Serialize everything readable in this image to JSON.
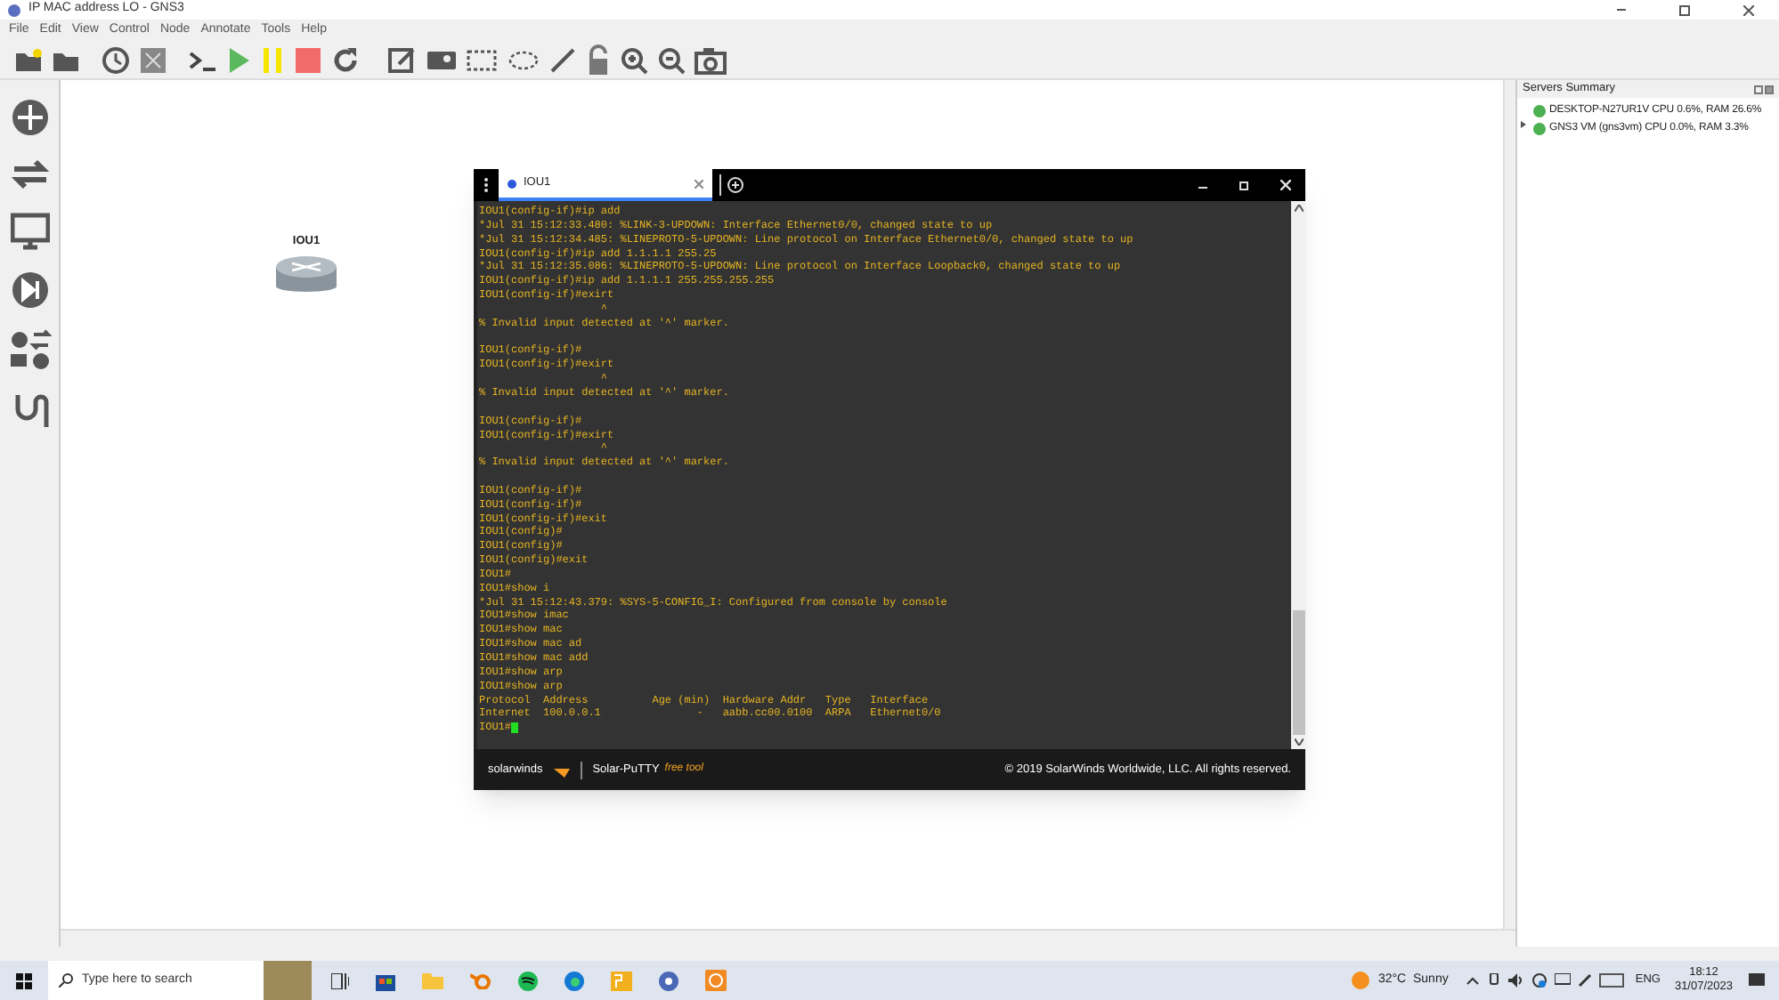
{
  "window": {
    "title": "IP MAC address LO - GNS3"
  },
  "menu": [
    "File",
    "Edit",
    "View",
    "Control",
    "Node",
    "Annotate",
    "Tools",
    "Help"
  ],
  "canvas": {
    "nodes": [
      {
        "label": "IOU1"
      }
    ]
  },
  "servers_summary": {
    "title": "Servers Summary",
    "items": [
      {
        "kind": "leaf",
        "text": "DESKTOP-N27UR1V CPU 0.6%, RAM 26.6%",
        "color": "#4caf50"
      },
      {
        "kind": "branch",
        "text": "GNS3 VM (gns3vm) CPU 0.0%, RAM 3.3%",
        "color": "#4caf50"
      }
    ]
  },
  "terminal": {
    "tabs": [
      {
        "label": "IOU1",
        "selected": true
      }
    ],
    "output": "IOU1(config-if)#ip add\n*Jul 31 15:12:33.480: %LINK-3-UPDOWN: Interface Ethernet0/0, changed state to up\n*Jul 31 15:12:34.485: %LINEPROTO-5-UPDOWN: Line protocol on Interface Ethernet0/0, changed state to up\nIOU1(config-if)#ip add 1.1.1.1 255.25\n*Jul 31 15:12:35.086: %LINEPROTO-5-UPDOWN: Line protocol on Interface Loopback0, changed state to up\nIOU1(config-if)#ip add 1.1.1.1 255.255.255.255\nIOU1(config-if)#exirt\n                   ^\n% Invalid input detected at '^' marker.\n\nIOU1(config-if)#\nIOU1(config-if)#exirt\n                   ^\n% Invalid input detected at '^' marker.\n\nIOU1(config-if)#\nIOU1(config-if)#exirt\n                   ^\n% Invalid input detected at '^' marker.\n\nIOU1(config-if)#\nIOU1(config-if)#\nIOU1(config-if)#exit\nIOU1(config)#\nIOU1(config)#\nIOU1(config)#exit\nIOU1#\nIOU1#show i\n*Jul 31 15:12:43.379: %SYS-5-CONFIG_I: Configured from console by console\nIOU1#show imac\nIOU1#show mac\nIOU1#show mac ad\nIOU1#show mac add\nIOU1#show arp\nIOU1#show arp\nProtocol  Address          Age (min)  Hardware Addr   Type   Interface\nInternet  100.0.0.1               -   aabb.cc00.0100  ARPA   Ethernet0/0\nIOU1#",
    "footer": {
      "brand": "solarwinds",
      "product": "Solar-PuTTY",
      "edition": "free tool",
      "copyright": "© 2019 SolarWinds Worldwide, LLC. All rights reserved."
    }
  },
  "taskbar": {
    "search_placeholder": "Type here to search",
    "weather": "32°C  Sunny",
    "language": "ENG",
    "time": "18:12",
    "date": "31/07/2023"
  }
}
